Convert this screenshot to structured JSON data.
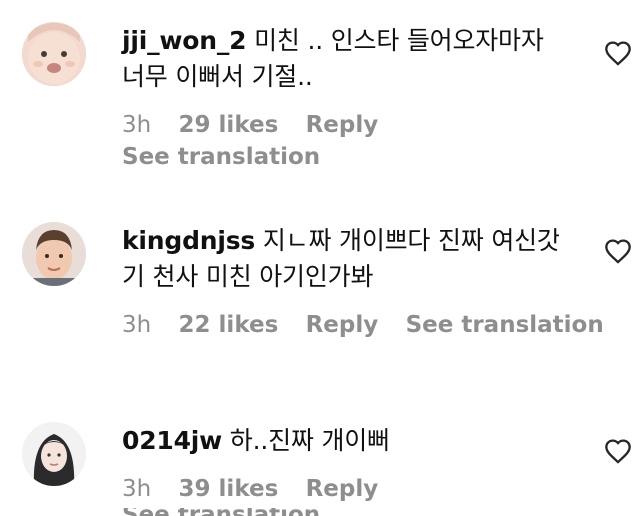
{
  "comments": [
    {
      "username": "jji_won_2",
      "text": "미친 .. 인스타 들어오자마자 너무 이뻐서 기절..",
      "time": "3h",
      "likes": "29 likes",
      "reply": "Reply",
      "see_translation": "See translation"
    },
    {
      "username": "kingdnjss",
      "text": "지ㄴ짜 개이쁘다 진짜 여신갓기 천사 미친 아기인가봐",
      "time": "3h",
      "likes": "22 likes",
      "reply": "Reply",
      "see_translation": "See translation"
    },
    {
      "username": "0214jw",
      "text": "하..진짜 개이뻐",
      "time": "3h",
      "likes": "39 likes",
      "reply": "Reply",
      "see_translation": "See translation"
    }
  ],
  "icons": {
    "like": "heart-outline-icon"
  },
  "colors": {
    "text": "#111111",
    "meta": "#8e8e8e",
    "background": "#ffffff"
  }
}
